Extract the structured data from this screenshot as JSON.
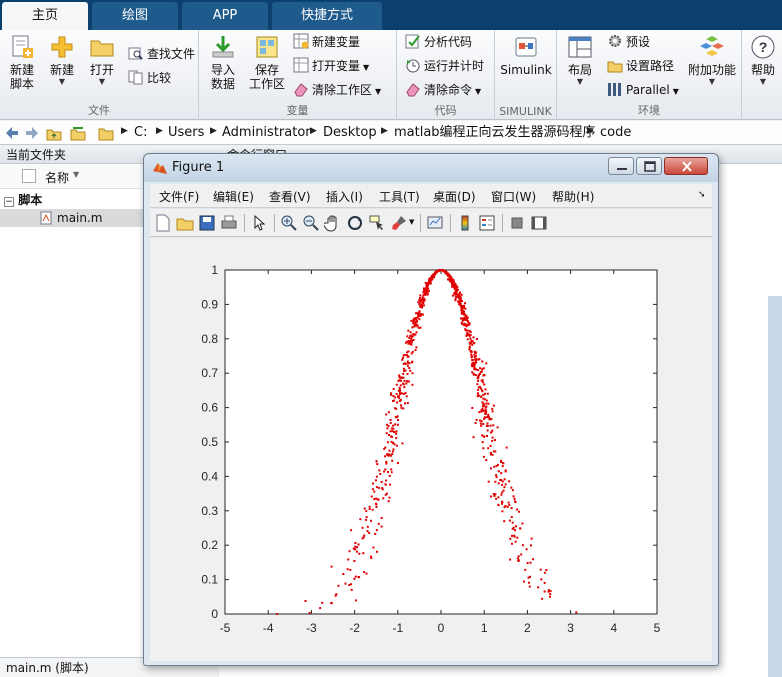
{
  "tabs": [
    {
      "label": "主页",
      "active": true
    },
    {
      "label": "绘图",
      "active": false
    },
    {
      "label": "APP",
      "active": false
    },
    {
      "label": "快捷方式",
      "active": false
    }
  ],
  "ribbon": {
    "file": {
      "group_label": "文件",
      "new_script": "新建\n脚本",
      "new": "新建",
      "open": "打开",
      "find_files": "查找文件",
      "compare": "比较"
    },
    "variable": {
      "group_label": "变量",
      "import_data": "导入\n数据",
      "save_workspace": "保存\n工作区",
      "new_variable": "新建变量",
      "open_variable": "打开变量",
      "clear_workspace": "清除工作区"
    },
    "code": {
      "group_label": "代码",
      "analyze_code": "分析代码",
      "run_and_time": "运行并计时",
      "clear_commands": "清除命令"
    },
    "simulink": {
      "group_label": "SIMULINK",
      "simulink": "Simulink"
    },
    "environment": {
      "group_label": "环境",
      "layout": "布局",
      "preferences": "预设",
      "set_path": "设置路径",
      "parallel": "Parallel",
      "add_ons": "附加功能"
    },
    "help": "帮助"
  },
  "address": {
    "crumbs": [
      "C:",
      "Users",
      "Administrator",
      "Desktop",
      "matlab编程正向云发生器源码程序",
      "code"
    ]
  },
  "left_panel": {
    "title": "当前文件夹",
    "column_name": "名称",
    "group": "脚本",
    "file": "main.m",
    "status": "main.m  (脚本)"
  },
  "right_panel": {
    "title": "命令行窗口"
  },
  "figure": {
    "title": "Figure 1",
    "menus": [
      "文件(F)",
      "编辑(E)",
      "查看(V)",
      "插入(I)",
      "工具(T)",
      "桌面(D)",
      "窗口(W)",
      "帮助(H)"
    ],
    "toolbar_icons": [
      "new-figure-icon",
      "open-file-icon",
      "save-icon",
      "print-icon",
      "pointer-icon",
      "zoom-in-icon",
      "zoom-out-icon",
      "pan-hand-icon",
      "rotate-3d-icon",
      "data-cursor-icon",
      "brush-icon",
      "link-plot-icon",
      "colorbar-icon",
      "legend-icon",
      "hide-plot-tools-icon",
      "show-plot-tools-icon"
    ]
  },
  "chart_data": {
    "type": "scatter",
    "title": "",
    "xlabel": "",
    "ylabel": "",
    "xlim": [
      -5,
      5
    ],
    "ylim": [
      0,
      1
    ],
    "xticks": [
      -5,
      -4,
      -3,
      -2,
      -1,
      0,
      1,
      2,
      3,
      4,
      5
    ],
    "yticks": [
      0,
      0.1,
      0.2,
      0.3,
      0.4,
      0.5,
      0.6,
      0.7,
      0.8,
      0.9,
      1
    ],
    "marker_color": "#e00000",
    "grid": false,
    "model": "normal cloud: y = exp(-x^2 / (2*En'^2)), Ex = 0, En = 1, He = 0.1",
    "point_count": 1000
  },
  "colors": {
    "tab_bar": "#0b3f6e",
    "plot_marker": "#e00000"
  }
}
